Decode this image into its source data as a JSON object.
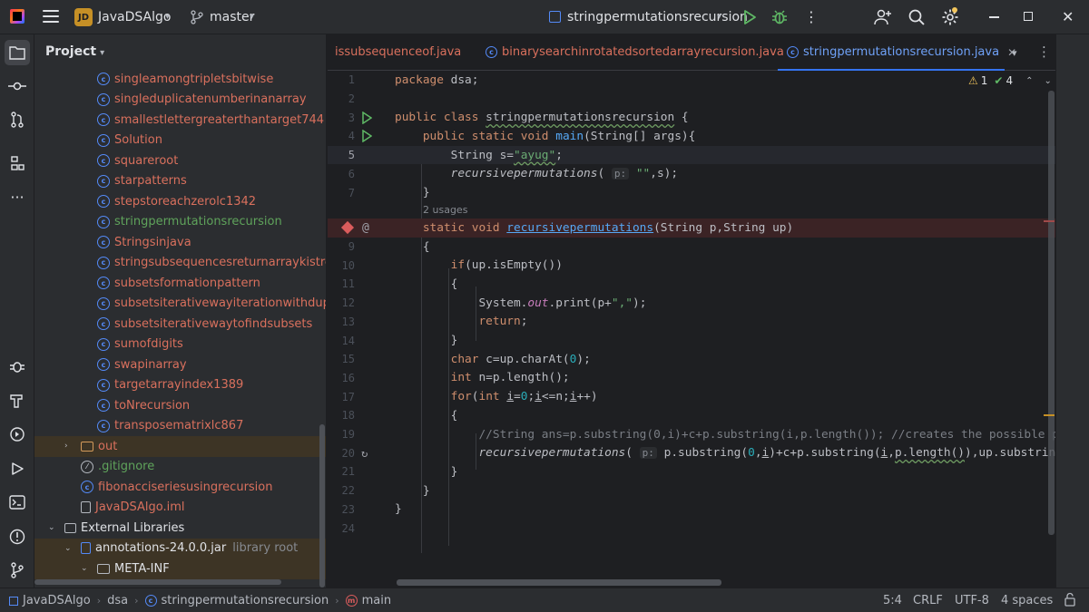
{
  "titlebar": {
    "project_badge": "JD",
    "project_name": "JavaDSAlgo",
    "branch": "master",
    "run_config": "stringpermutationsrecursion"
  },
  "project_panel": {
    "header": "Project",
    "items": [
      {
        "label": "singleamongtripletsbitwise",
        "type": "class",
        "color": "red"
      },
      {
        "label": "singleduplicatenumberinanarray",
        "type": "class",
        "color": "red"
      },
      {
        "label": "smallestlettergreaterthantarget744",
        "type": "class",
        "color": "red"
      },
      {
        "label": "Solution",
        "type": "class",
        "color": "red"
      },
      {
        "label": "squareroot",
        "type": "class",
        "color": "red"
      },
      {
        "label": "starpatterns",
        "type": "class",
        "color": "red"
      },
      {
        "label": "stepstoreachzerolc1342",
        "type": "class",
        "color": "red"
      },
      {
        "label": "stringpermutationsrecursion",
        "type": "class",
        "color": "green"
      },
      {
        "label": "Stringsinjava",
        "type": "class",
        "color": "red"
      },
      {
        "label": "stringsubsequencesreturnarraykistrecursi",
        "type": "class",
        "color": "red"
      },
      {
        "label": "subsetsformationpattern",
        "type": "class",
        "color": "red"
      },
      {
        "label": "subsetsiterativewayiterationwithduplicat",
        "type": "class",
        "color": "red"
      },
      {
        "label": "subsetsiterativewaytofindsubsets",
        "type": "class",
        "color": "red"
      },
      {
        "label": "sumofdigits",
        "type": "class",
        "color": "red"
      },
      {
        "label": "swapinarray",
        "type": "class",
        "color": "red"
      },
      {
        "label": "targetarrayindex1389",
        "type": "class",
        "color": "red"
      },
      {
        "label": "toNrecursion",
        "type": "class",
        "color": "red"
      },
      {
        "label": "transposematrixlc867",
        "type": "class",
        "color": "red"
      }
    ],
    "out_folder": "out",
    "gitignore": ".gitignore",
    "fib_file": "fibonacciseriesusingrecursion",
    "iml_file": "JavaDSAlgo.iml",
    "external_libraries": "External Libraries",
    "jar": "annotations-24.0.0.jar",
    "jar_note": "library root",
    "meta_inf": "META-INF"
  },
  "tabs": [
    {
      "label": "issubsequenceof.java"
    },
    {
      "label": "binarysearchinrotatedsortedarrayrecursion.java"
    },
    {
      "label": "stringpermutationsrecursion.java"
    }
  ],
  "editor": {
    "warnings": "1",
    "checks": "4",
    "usages_hint": "2 usages",
    "param_hint": "p:",
    "line_numbers": [
      "1",
      "2",
      "3",
      "4",
      "5",
      "6",
      "7",
      "9",
      "10",
      "11",
      "12",
      "13",
      "14",
      "15",
      "16",
      "17",
      "18",
      "19",
      "20",
      "21",
      "22",
      "23",
      "24"
    ]
  },
  "statusbar": {
    "crumbs": [
      "JavaDSAlgo",
      "dsa",
      "stringpermutationsrecursion",
      "main"
    ],
    "position": "5:4",
    "line_sep": "CRLF",
    "encoding": "UTF-8",
    "indent": "4 spaces"
  }
}
